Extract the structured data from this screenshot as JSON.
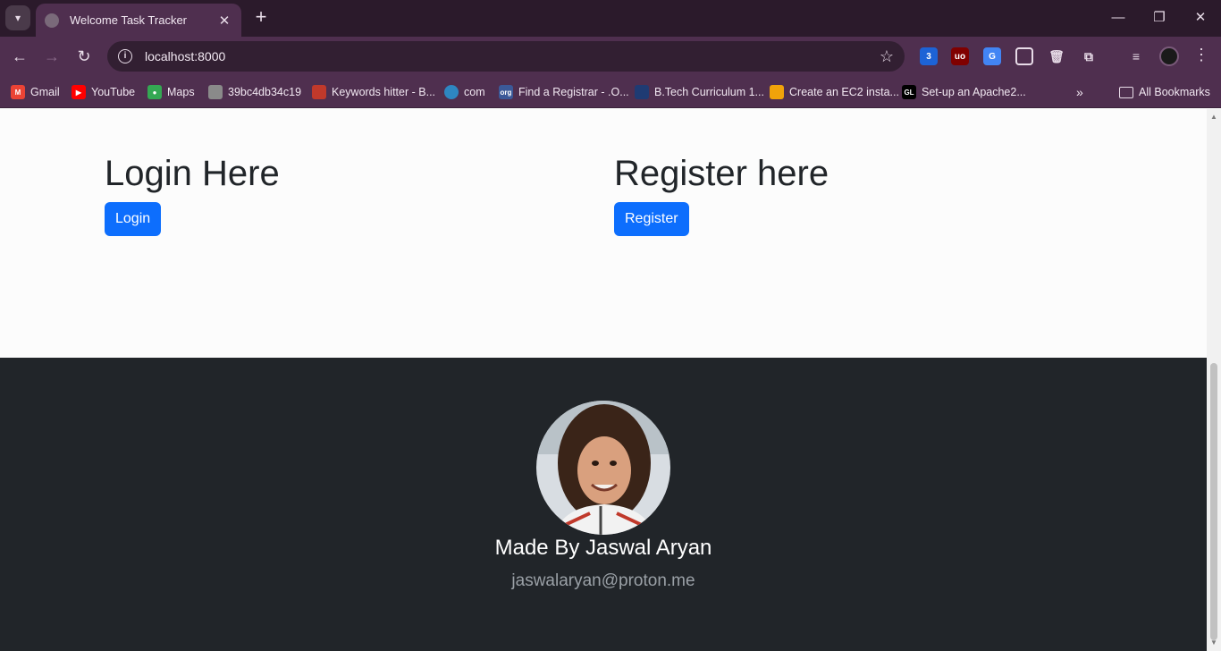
{
  "browser": {
    "tab_title": "Welcome Task Tracker",
    "url": "localhost:8000",
    "extension_badge": "3",
    "bookmarks": [
      {
        "label": "Gmail",
        "icon": "gmail-icon",
        "color": "#ea4335"
      },
      {
        "label": "YouTube",
        "icon": "youtube-icon",
        "color": "#ff0000"
      },
      {
        "label": "Maps",
        "icon": "maps-icon",
        "color": "#34a853"
      },
      {
        "label": "39bc4db34c19",
        "icon": "page-icon",
        "color": "#8a8a8a"
      },
      {
        "label": "Keywords hitter - B...",
        "icon": "page-icon",
        "color": "#c0392b"
      },
      {
        "label": "com",
        "icon": "globe-icon",
        "color": "#2e86c1"
      },
      {
        "label": "Find a Registrar - .O...",
        "icon": "org-icon",
        "color": "#3b5998"
      },
      {
        "label": "B.Tech Curriculum 1...",
        "icon": "page-icon",
        "color": "#1f3b73"
      },
      {
        "label": "Create an EC2 insta...",
        "icon": "aws-icon",
        "color": "#f0a30a"
      },
      {
        "label": "Set-up an Apache2...",
        "icon": "gl-icon",
        "color": "#000000"
      }
    ],
    "all_bookmarks": "All Bookmarks"
  },
  "main": {
    "login_heading": "Login Here",
    "login_button": "Login",
    "register_heading": "Register here",
    "register_button": "Register"
  },
  "footer": {
    "made_by": "Made By Jaswal Aryan",
    "email": "jaswalaryan@proton.me"
  },
  "colors": {
    "primary": "#0d6efd",
    "footer_bg": "#212529",
    "chrome_bg": "#4f2f4f"
  }
}
